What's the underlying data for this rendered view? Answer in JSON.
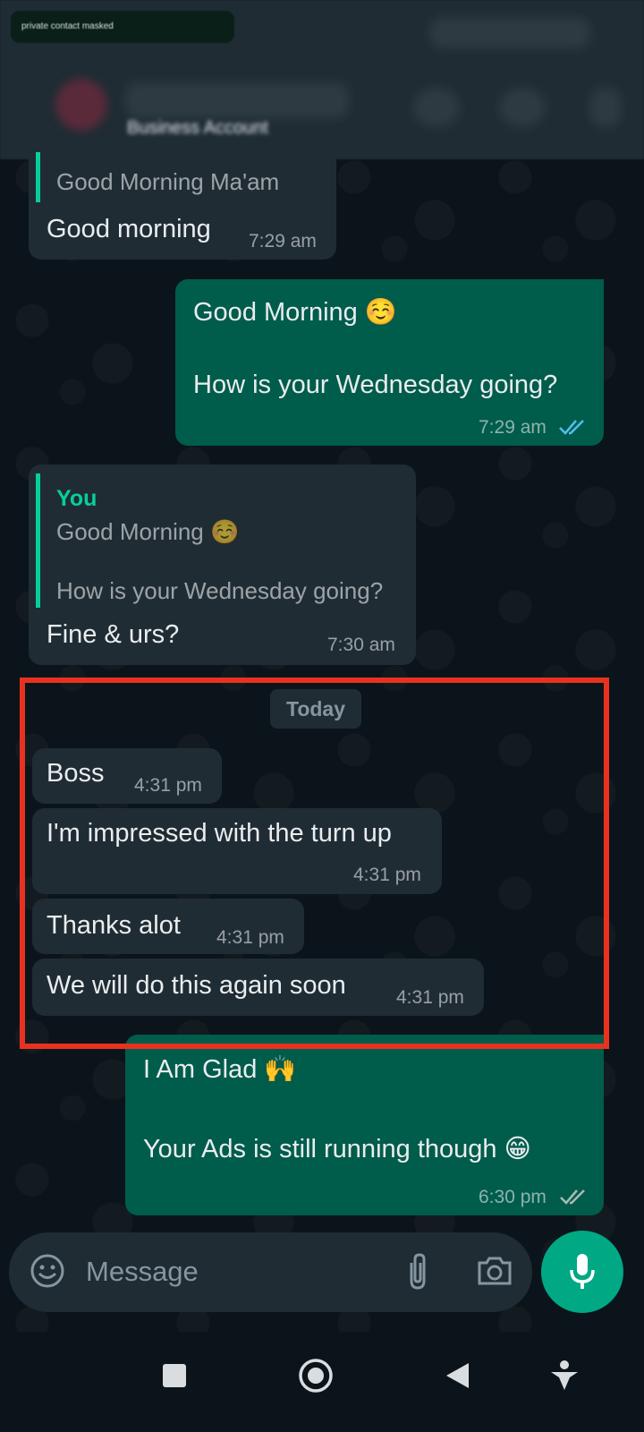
{
  "header": {
    "masked_label": "private contact masked",
    "subtitle": "Business Account"
  },
  "messages": [
    {
      "quote": "Good Morning Ma'am",
      "text": "Good morning",
      "time": "7:29 am"
    },
    {
      "line1": "Good Morning ☺️",
      "line2": "How is your Wednesday going?",
      "time": "7:29 am"
    },
    {
      "quote_name": "You",
      "quote_line1": "Good Morning ☺️",
      "quote_line2": "How is your Wednesday going?",
      "text": "Fine & urs?",
      "time": "7:30 am"
    }
  ],
  "date_chip": "Today",
  "today": [
    {
      "text": "Boss",
      "time": "4:31 pm"
    },
    {
      "text": "I'm impressed with the turn up",
      "time": "4:31 pm"
    },
    {
      "text": "Thanks alot",
      "time": "4:31 pm"
    },
    {
      "text": "We will do this again soon",
      "time": "4:31 pm"
    }
  ],
  "last_out": {
    "line1": "I Am Glad 🙌",
    "line2": "Your Ads is still running though 😁",
    "time": "6:30 pm"
  },
  "input": {
    "placeholder": "Message"
  },
  "icons": {
    "emoji": "emoji-icon",
    "attach": "paperclip-icon",
    "camera": "camera-icon",
    "mic": "microphone-icon",
    "read_ticks": "double-check-icon",
    "nav_recent": "square-icon",
    "nav_home": "circle-icon",
    "nav_back": "triangle-back-icon",
    "nav_assist": "accessibility-icon"
  },
  "colors": {
    "accent": "#00a884",
    "outgoing": "#005c4b",
    "incoming": "#202c33",
    "highlight": "#e8321f",
    "read_tick": "#53bdeb"
  }
}
